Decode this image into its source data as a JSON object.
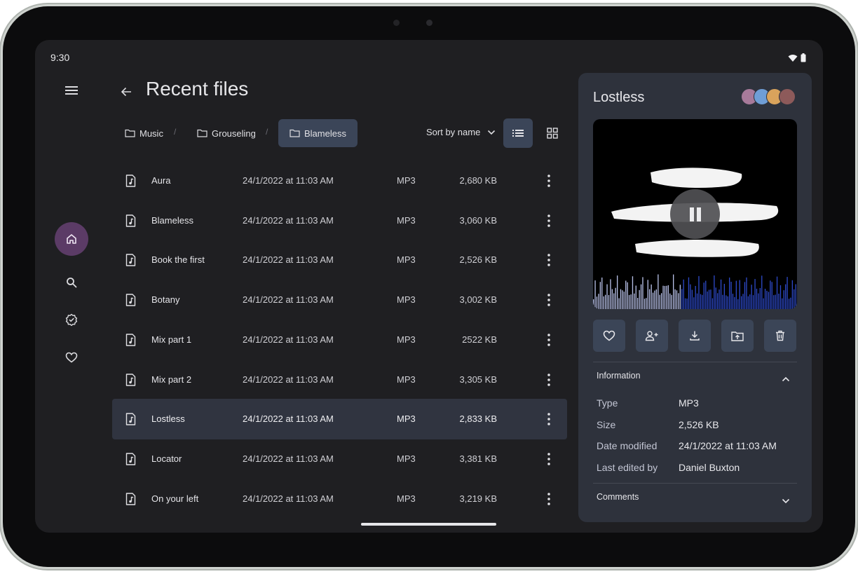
{
  "status": {
    "time": "9:30"
  },
  "header": {
    "title": "Recent files"
  },
  "breadcrumbs": [
    {
      "label": "Music"
    },
    {
      "label": "Grouseling"
    },
    {
      "label": "Blameless"
    }
  ],
  "toolbar": {
    "sort_label": "Sort by name"
  },
  "files": [
    {
      "name": "Aura",
      "date": "24/1/2022 at 11:03 AM",
      "type": "MP3",
      "size": "2,680 KB"
    },
    {
      "name": "Blameless",
      "date": "24/1/2022 at 11:03 AM",
      "type": "MP3",
      "size": "3,060 KB"
    },
    {
      "name": "Book the first",
      "date": "24/1/2022 at 11:03 AM",
      "type": "MP3",
      "size": "2,526 KB"
    },
    {
      "name": "Botany",
      "date": "24/1/2022 at 11:03 AM",
      "type": "MP3",
      "size": "3,002 KB"
    },
    {
      "name": "Mix part 1",
      "date": "24/1/2022 at 11:03 AM",
      "type": "MP3",
      "size": "2522 KB"
    },
    {
      "name": "Mix part 2",
      "date": "24/1/2022 at 11:03 AM",
      "type": "MP3",
      "size": "3,305 KB"
    },
    {
      "name": "Lostless",
      "date": "24/1/2022 at 11:03 AM",
      "type": "MP3",
      "size": "2,833 KB",
      "selected": true
    },
    {
      "name": "Locator",
      "date": "24/1/2022 at 11:03 AM",
      "type": "MP3",
      "size": "3,381 KB"
    },
    {
      "name": "On your left",
      "date": "24/1/2022 at 11:03 AM",
      "type": "MP3",
      "size": "3,219 KB"
    }
  ],
  "detail": {
    "title": "Lostless",
    "player": {
      "state": "playing",
      "progress": 0.43
    },
    "info_heading": "Information",
    "info": [
      {
        "label": "Type",
        "value": "MP3"
      },
      {
        "label": "Size",
        "value": "2,526 KB"
      },
      {
        "label": "Date modified",
        "value": "24/1/2022 at 11:03 AM"
      },
      {
        "label": "Last edited by",
        "value": "Daniel Buxton"
      }
    ],
    "comments_heading": "Comments"
  },
  "colors": {
    "screen_bg": "#1f1f22",
    "panel_bg": "#2e323c",
    "accent": "#3b4558",
    "home_active": "#5b3b66",
    "wave_played": "#b6bfe6",
    "wave_unplayed": "#2d49c6"
  },
  "icons": [
    "menu-icon",
    "back-arrow-icon",
    "folder-icon",
    "chevron-down-icon",
    "list-view-icon",
    "grid-view-icon",
    "audio-file-icon",
    "more-vert-icon",
    "home-icon",
    "search-icon",
    "verified-icon",
    "heart-icon",
    "pause-icon",
    "person-add-icon",
    "download-icon",
    "move-to-folder-icon",
    "delete-icon",
    "chevron-up-icon",
    "wifi-icon",
    "battery-icon"
  ]
}
